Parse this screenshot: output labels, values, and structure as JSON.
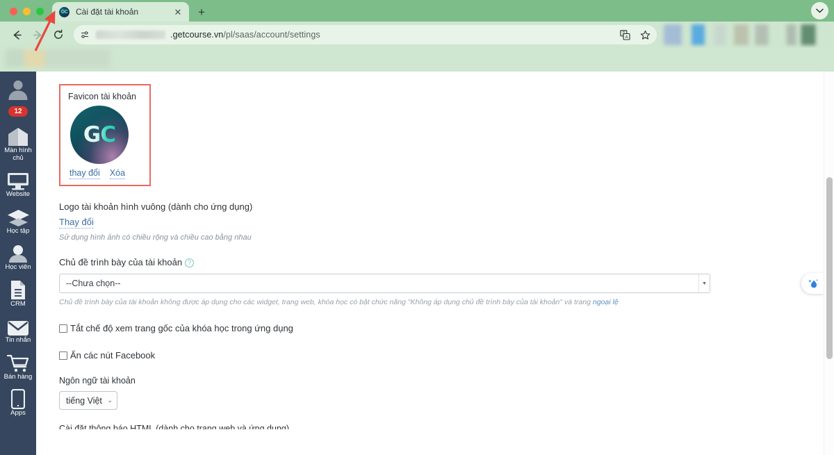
{
  "browser": {
    "tab": {
      "title": "Cài đặt tài khoản",
      "favicon_text": "GC",
      "favicon_icon": "gc-logo-icon",
      "close_icon": "close-icon"
    },
    "new_tab_icon": "plus-icon",
    "tab_list_icon": "chevron-down-icon",
    "back_icon": "arrow-left-icon",
    "forward_icon": "arrow-right-icon",
    "reload_icon": "reload-icon",
    "omnibox": {
      "site_settings_icon": "tune-icon",
      "url_host_suffix": ".getcourse.vn",
      "url_path": "/pl/saas/account/settings",
      "translate_icon": "translate-icon",
      "bookmark_icon": "star-icon"
    }
  },
  "sidebar": {
    "avatar_icon": "user-avatar-icon",
    "badge_count": "12",
    "items": [
      {
        "label": "Màn hình chủ",
        "icon": "home-icon"
      },
      {
        "label": "Website",
        "icon": "monitor-icon"
      },
      {
        "label": "Học tập",
        "icon": "graduation-cap-icon"
      },
      {
        "label": "Học viên",
        "icon": "student-icon"
      },
      {
        "label": "CRM",
        "icon": "document-icon"
      },
      {
        "label": "Tin nhắn",
        "icon": "envelope-icon"
      },
      {
        "label": "Bán hàng",
        "icon": "shopping-cart-icon"
      },
      {
        "label": "Apps",
        "icon": "mobile-phone-icon"
      }
    ]
  },
  "main": {
    "favicon_card": {
      "title": "Favicon tài khoản",
      "logo_text": "GC",
      "change_link": "thay đổi",
      "delete_link": "Xóa",
      "highlight_color": "#e8695f"
    },
    "square_logo": {
      "label": "Logo tài khoản hình vuông (dành cho ứng dụng)",
      "change_link": "Thay đổi",
      "hint": "Sử dụng hình ảnh có chiều rộng và chiều cao bằng nhau"
    },
    "theme": {
      "label": "Chủ đề trình bày của tài khoản",
      "help_icon": "question-mark-icon",
      "selected_option": "--Chưa chọn--",
      "caret_icon": "caret-down-icon",
      "note_part1": "Chủ đề trình bày của tài khoản không được áp dụng cho các widget, trang web, khóa học có bật chức năng \"Không áp dụng chủ đề trình bày của tài khoản\" và trang ",
      "note_link": "ngoại lệ"
    },
    "checkboxes": [
      {
        "label": "Tắt chế độ xem trang gốc của khóa học trong ứng dụng",
        "checked": false
      },
      {
        "label": "Ẩn các nút Facebook",
        "checked": false
      }
    ],
    "language": {
      "label": "Ngôn ngữ tài khoản",
      "selected": "tiếng Việt",
      "caret_icon": "caret-down-icon"
    },
    "cut_off_text": "Cài đặt thông báo HTML (dành cho trang web và ứng dụng)"
  },
  "widget": {
    "icon": "water-drop-sparkle-icon"
  },
  "annotation": {
    "arrow_color": "#e8493d",
    "arrow_name": "red-pointer-arrow"
  }
}
